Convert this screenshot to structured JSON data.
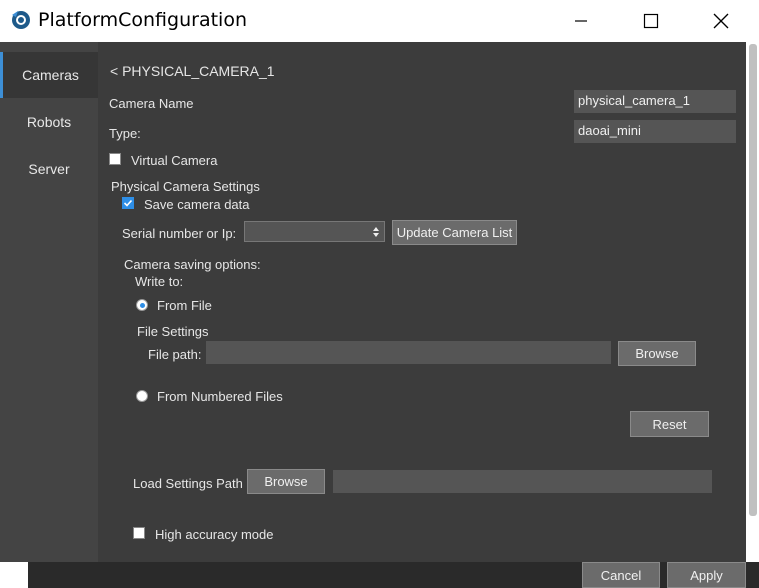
{
  "window": {
    "title": "PlatformConfiguration"
  },
  "sidebar": {
    "items": [
      {
        "label": "Cameras",
        "active": true
      },
      {
        "label": "Robots",
        "active": false
      },
      {
        "label": "Server",
        "active": false
      }
    ]
  },
  "main": {
    "back_label": "< PHYSICAL_CAMERA_1",
    "camera_name_label": "Camera Name",
    "camera_name_value": "physical_camera_1",
    "type_label": "Type:",
    "type_value": "daoai_mini",
    "virtual_camera_label": "Virtual Camera",
    "physical_settings_title": "Physical Camera Settings",
    "save_camera_data_label": "Save camera data",
    "serial_label": "Serial number or Ip:",
    "serial_value": "",
    "update_camera_list_label": "Update Camera List",
    "saving_options_title": "Camera saving options:",
    "write_to_label": "Write to:",
    "from_file_label": "From File",
    "file_settings_title": "File Settings",
    "file_path_label": "File path:",
    "file_path_value": "",
    "browse_label": "Browse",
    "from_numbered_label": "From Numbered Files",
    "reset_label": "Reset",
    "load_settings_label": "Load Settings Path",
    "load_browse_label": "Browse",
    "load_settings_value": "",
    "high_accuracy_label": "High accuracy mode"
  },
  "footer": {
    "cancel_label": "Cancel",
    "apply_label": "Apply"
  },
  "colors": {
    "accent": "#2e8ee6",
    "sidebar_bg": "#444444",
    "panel_bg": "#3c3c3c"
  },
  "icons": {
    "app": "camera-eye-icon",
    "minimize": "minimize-icon",
    "maximize": "maximize-icon",
    "close": "close-icon"
  }
}
